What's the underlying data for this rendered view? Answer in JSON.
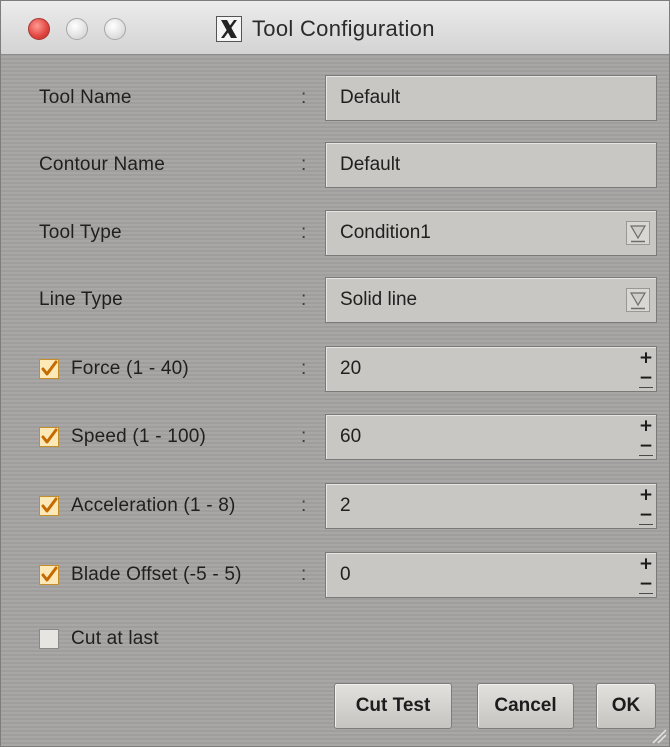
{
  "window": {
    "title": "Tool Configuration",
    "title_icon": "x11-icon"
  },
  "fields": {
    "tool_name": {
      "label": "Tool Name",
      "colon": ":",
      "value": "Default"
    },
    "contour_name": {
      "label": "Contour Name",
      "colon": ":",
      "value": "Default"
    },
    "tool_type": {
      "label": "Tool Type",
      "colon": ":",
      "value": "Condition1"
    },
    "line_type": {
      "label": "Line Type",
      "colon": ":",
      "value": "Solid line"
    },
    "force": {
      "label": "Force (1 - 40)",
      "colon": ":",
      "value": "20",
      "checked": true
    },
    "speed": {
      "label": "Speed (1 - 100)",
      "colon": ":",
      "value": "60",
      "checked": true
    },
    "acceleration": {
      "label": "Acceleration (1 - 8)",
      "colon": ":",
      "value": "2",
      "checked": true
    },
    "blade_offset": {
      "label": "Blade Offset (-5 - 5)",
      "colon": ":",
      "value": "0",
      "checked": true
    }
  },
  "cut_at_last": {
    "label": "Cut at last",
    "checked": false
  },
  "buttons": {
    "cut_test": "Cut Test",
    "cancel": "Cancel",
    "ok": "OK"
  },
  "stepper": {
    "plus": "+",
    "minus": "−"
  },
  "colors": {
    "close_button": "#e0443e",
    "checkbox_checked": "#fde8b8",
    "checkmark": "#c46a00",
    "panel": "#a3a2a0",
    "field": "#c9c7c3"
  }
}
